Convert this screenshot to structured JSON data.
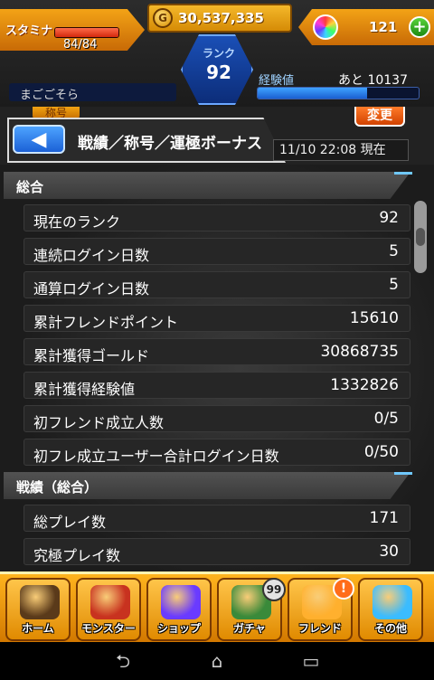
{
  "hud": {
    "stamina_label": "スタミナ",
    "stamina_value": "84/84",
    "stamina_fraction": 1.0,
    "gold_value": "30,537,335",
    "orb_value": "121",
    "plus_label": "+",
    "rank_label": "ランク",
    "rank_value": "92",
    "player_name": "まごごそら",
    "exp_label": "経験値",
    "exp_remaining": "あと 10137",
    "exp_fraction": 0.68
  },
  "header": {
    "badge_behind": "称号",
    "back_label": "◀",
    "title": "戦績／称号／運極ボーナス",
    "change_button": "変更",
    "datetime": "11/10 22:08 現在"
  },
  "sections": [
    {
      "title": "総合",
      "rows": [
        {
          "label": "現在のランク",
          "value": "92"
        },
        {
          "label": "連続ログイン日数",
          "value": "5"
        },
        {
          "label": "通算ログイン日数",
          "value": "5"
        },
        {
          "label": "累計フレンドポイント",
          "value": "15610"
        },
        {
          "label": "累計獲得ゴールド",
          "value": "30868735"
        },
        {
          "label": "累計獲得経験値",
          "value": "1332826"
        },
        {
          "label": "初フレンド成立人数",
          "value": "0/5"
        },
        {
          "label": "初フレ成立ユーザー合計ログイン日数",
          "value": "0/50"
        }
      ]
    },
    {
      "title": "戦績（総合）",
      "rows": [
        {
          "label": "総プレイ数",
          "value": "171"
        },
        {
          "label": "究極プレイ数",
          "value": "30"
        }
      ]
    }
  ],
  "bottom_nav": [
    {
      "label": "ホーム",
      "color": "#5a3a1a"
    },
    {
      "label": "モンスター",
      "color": "#c8321f"
    },
    {
      "label": "ショップ",
      "color": "#6a3bff"
    },
    {
      "label": "ガチャ",
      "color": "#3a8a3a",
      "badge": "99"
    },
    {
      "label": "フレンド",
      "color": "#ffb02e",
      "alert": "!"
    },
    {
      "label": "その他",
      "color": "#3bbcff"
    }
  ],
  "system_bar": {
    "back": "⮌",
    "home": "⌂",
    "recent": "▭"
  }
}
